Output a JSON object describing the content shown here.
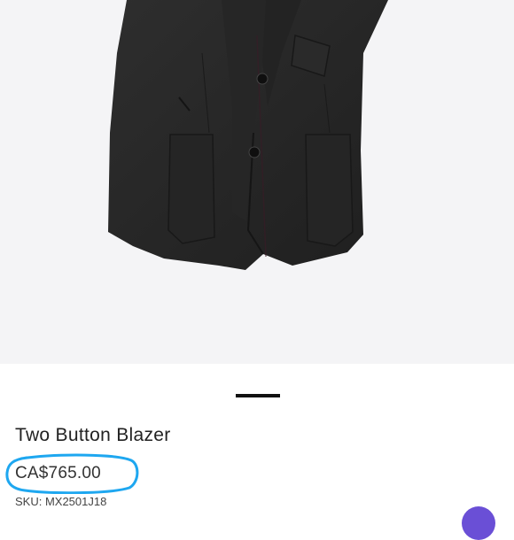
{
  "product": {
    "title": "Two Button Blazer",
    "price": "CA$765.00",
    "sku": "SKU: MX2501J18"
  },
  "image": {
    "subject": "charcoal-two-button-blazer",
    "background_color": "#f4f4f6"
  },
  "colors": {
    "highlight": "#1ea7f0",
    "chat_accent": "#6a4fd6"
  }
}
